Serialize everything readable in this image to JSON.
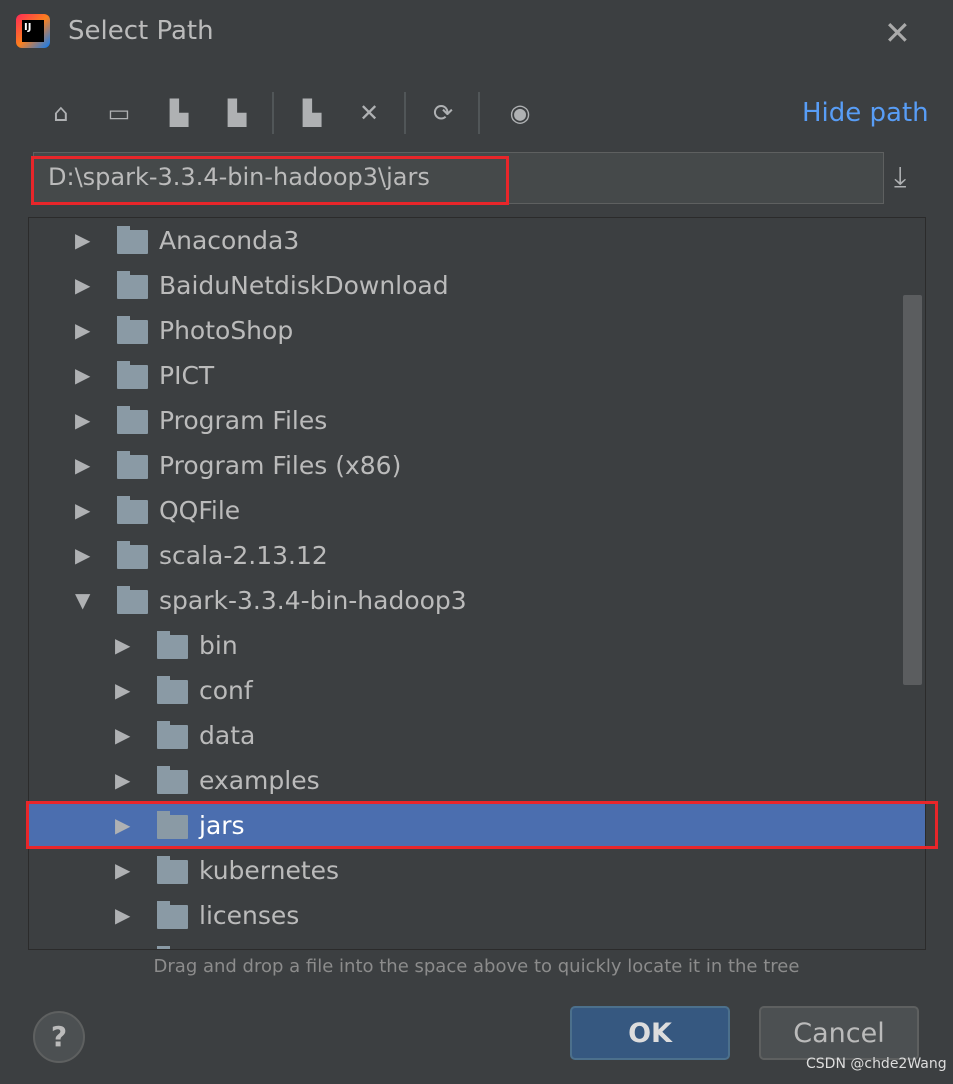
{
  "window": {
    "title": "Select Path",
    "logo_text": "IJ",
    "close_icon": "close-icon"
  },
  "toolbar": {
    "icons": [
      "home-icon",
      "desktop-icon",
      "project-folder-icon",
      "module-folder-icon",
      "new-folder-icon",
      "delete-icon",
      "refresh-icon",
      "show-hidden-icon"
    ],
    "hide_path_label": "Hide path"
  },
  "path_field": {
    "value": "D:\\spark-3.3.4-bin-hadoop3\\jars"
  },
  "tree": {
    "items": [
      {
        "label": "Anaconda3",
        "level": 1,
        "expanded": false
      },
      {
        "label": "BaiduNetdiskDownload",
        "level": 1,
        "expanded": false
      },
      {
        "label": "PhotoShop",
        "level": 1,
        "expanded": false
      },
      {
        "label": "PICT",
        "level": 1,
        "expanded": false
      },
      {
        "label": "Program Files",
        "level": 1,
        "expanded": false
      },
      {
        "label": "Program Files (x86)",
        "level": 1,
        "expanded": false
      },
      {
        "label": "QQFile",
        "level": 1,
        "expanded": false
      },
      {
        "label": "scala-2.13.12",
        "level": 1,
        "expanded": false
      },
      {
        "label": "spark-3.3.4-bin-hadoop3",
        "level": 1,
        "expanded": true
      },
      {
        "label": "bin",
        "level": 2,
        "expanded": false
      },
      {
        "label": "conf",
        "level": 2,
        "expanded": false
      },
      {
        "label": "data",
        "level": 2,
        "expanded": false
      },
      {
        "label": "examples",
        "level": 2,
        "expanded": false
      },
      {
        "label": "jars",
        "level": 2,
        "expanded": false,
        "selected": true
      },
      {
        "label": "kubernetes",
        "level": 2,
        "expanded": false
      },
      {
        "label": "licenses",
        "level": 2,
        "expanded": false
      }
    ]
  },
  "hint": "Drag and drop a file into the space above to quickly locate it in the tree",
  "buttons": {
    "help": "?",
    "ok": "OK",
    "cancel": "Cancel"
  },
  "watermark": "CSDN @chde2Wang",
  "colors": {
    "background": "#3c3f41",
    "selection": "#4b6eaf",
    "link": "#589df6",
    "highlight_box": "#e8262a"
  }
}
